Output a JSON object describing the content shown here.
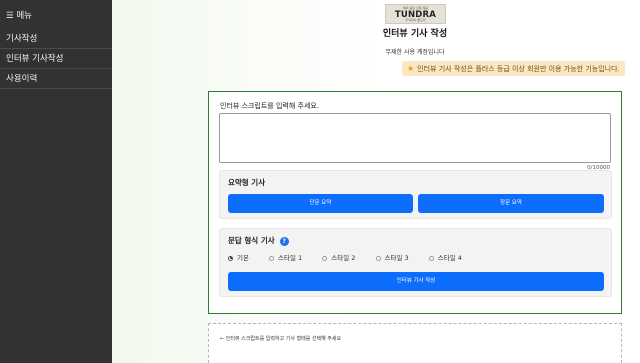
{
  "sidebar": {
    "menu_label": "☰ 메뉴",
    "items": [
      {
        "label": "기사작성"
      },
      {
        "label": "인터뷰 기사작성"
      },
      {
        "label": "사용이력"
      }
    ]
  },
  "header": {
    "logo_top": "해외 공보 신문 제공",
    "logo_brand": "TUNDRA",
    "logo_sub": "주식회사 툰드라",
    "title": "인터뷰 기사 작성",
    "subtitle": "무제한 사용 계정입니다",
    "notice": "인터뷰 기사 작성은 플러스 등급 이상 회원만 이용 가능한 기능입니다.",
    "notice_icon": "star-icon"
  },
  "form": {
    "script_label": "인터뷰 스크립트를 입력해 주세요.",
    "script_value": "",
    "counter": "0/10000",
    "summary": {
      "title": "요약형 기사",
      "short_button": "단문 요약",
      "long_button": "장문 요약"
    },
    "paragraph": {
      "title": "문답 형식 기사",
      "help_icon": "?",
      "styles": [
        "기본",
        "스타일 1",
        "스타일 2",
        "스타일 3",
        "스타일 4"
      ],
      "selected": "기본",
      "generate_button": "인터뷰 기사 작성"
    }
  },
  "output": {
    "hint": "← 인터뷰 스크립트를 입력하고 기사 형태를 선택해 주세요"
  },
  "colors": {
    "sidebar_bg": "#323232",
    "accent_blue": "#0d6efd",
    "panel_border": "#2e7d32",
    "notice_bg": "#fbe8c2"
  }
}
